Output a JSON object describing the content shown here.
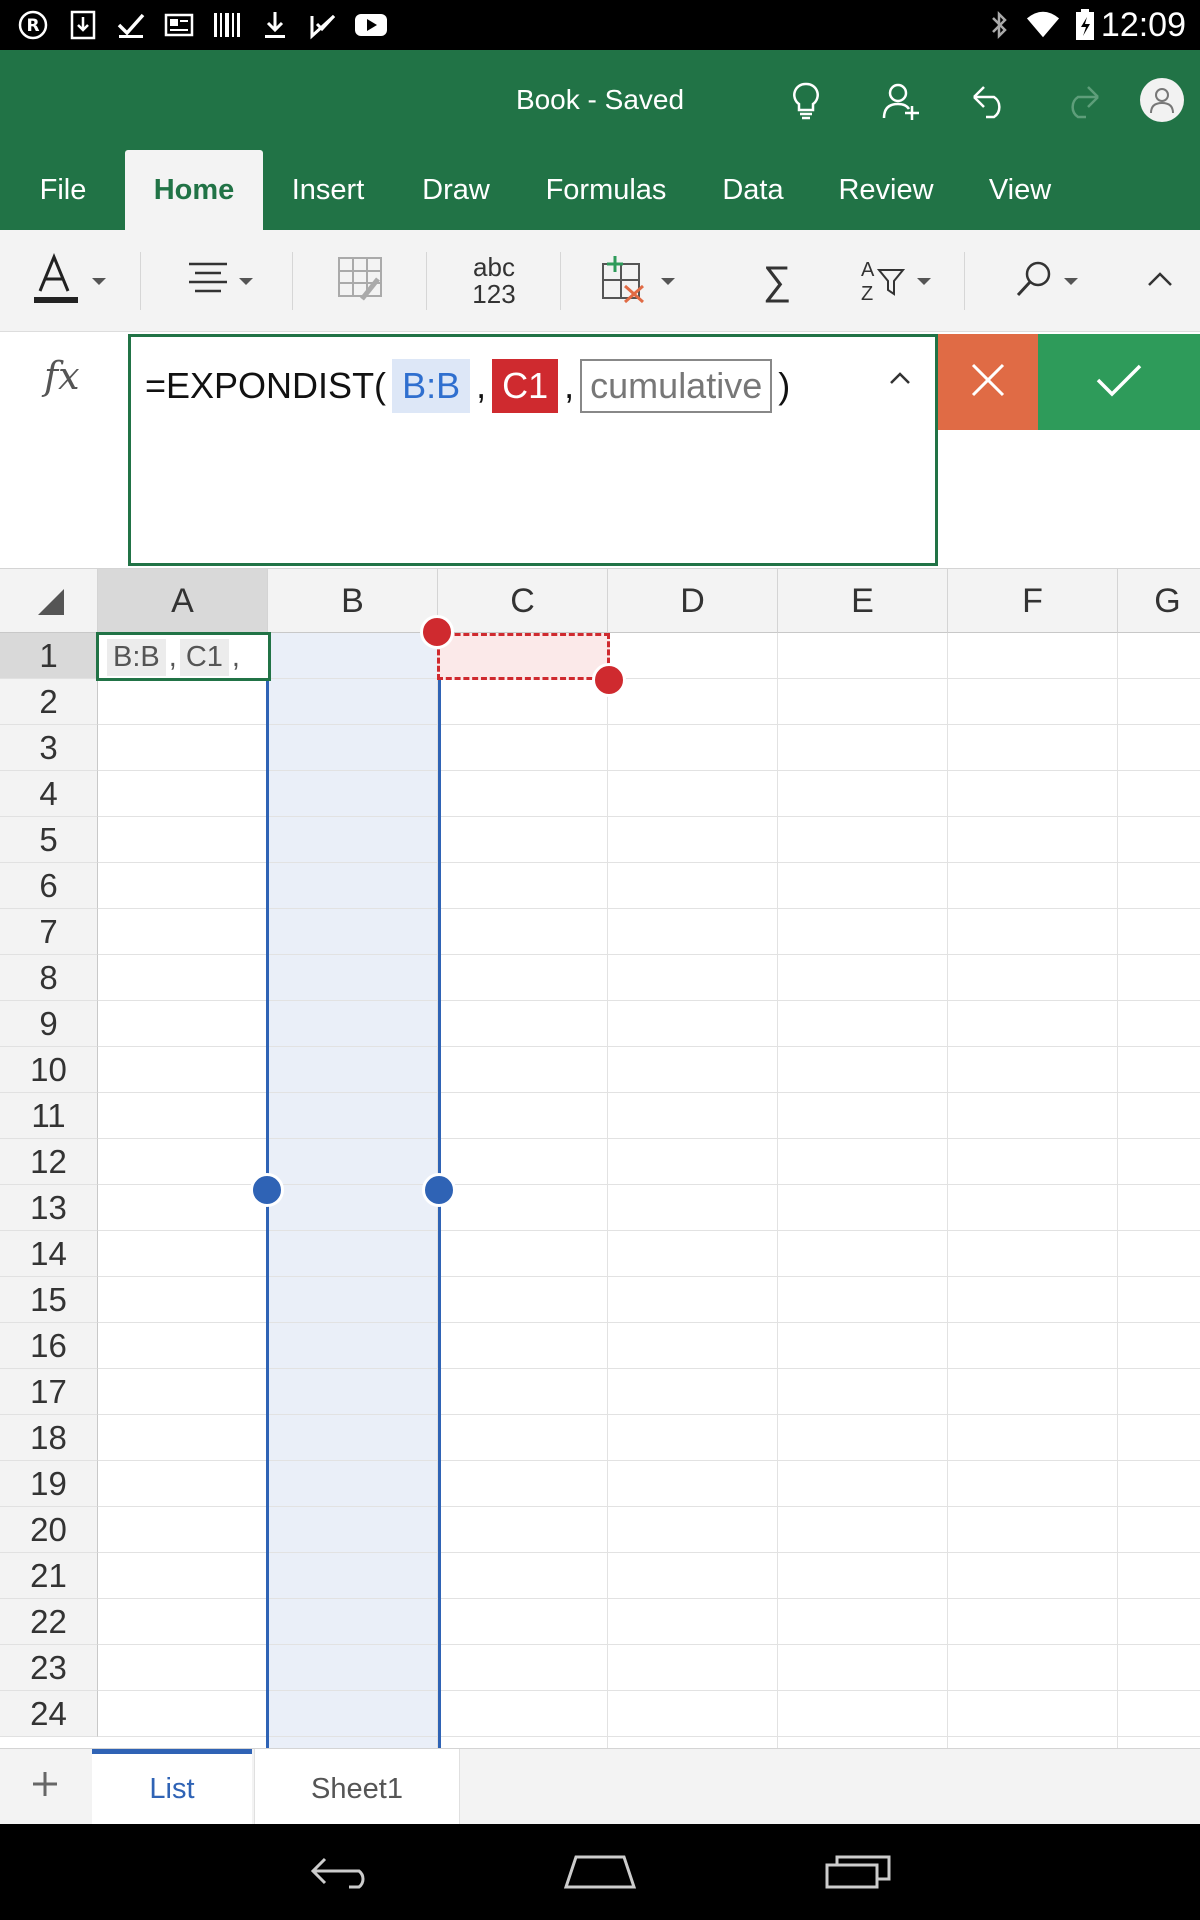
{
  "status_bar": {
    "time": "12:09"
  },
  "app": {
    "title": "Book - Saved"
  },
  "tabs": [
    {
      "label": "File"
    },
    {
      "label": "Home"
    },
    {
      "label": "Insert"
    },
    {
      "label": "Draw"
    },
    {
      "label": "Formulas"
    },
    {
      "label": "Data"
    },
    {
      "label": "Review"
    },
    {
      "label": "View"
    }
  ],
  "ribbon": {
    "spelling_label_top": "abc",
    "spelling_label_bottom": "123",
    "sum_symbol": "∑",
    "sort_a": "A",
    "sort_z": "Z"
  },
  "formula": {
    "fx_label": "fx",
    "prefix": "=EXPONDIST(",
    "arg1": "B:B",
    "sep1": ",",
    "arg2": "C1",
    "sep2": ",",
    "arg3_placeholder": "cumulative",
    "suffix": ")"
  },
  "grid": {
    "columns": [
      "A",
      "B",
      "C",
      "D",
      "E",
      "F",
      "G"
    ],
    "rows": [
      "1",
      "2",
      "3",
      "4",
      "5",
      "6",
      "7",
      "8",
      "9",
      "10",
      "11",
      "12",
      "13",
      "14",
      "15",
      "16",
      "17",
      "18",
      "19",
      "20",
      "21",
      "22",
      "23",
      "24"
    ],
    "cell_a1": {
      "tok1": "B:B",
      "sep1": ",",
      "tok2": "C1",
      "sep2": ","
    },
    "active_cell": "A1",
    "selected_column": "B",
    "referenced_cell": "C1"
  },
  "sheets": [
    {
      "label": "List"
    },
    {
      "label": "Sheet1"
    }
  ],
  "colors": {
    "excel_green": "#217346",
    "selection_blue": "#2f63b5",
    "reference_red": "#cf2a2f",
    "cancel_orange": "#e06b45",
    "confirm_green": "#2e9b5a"
  }
}
